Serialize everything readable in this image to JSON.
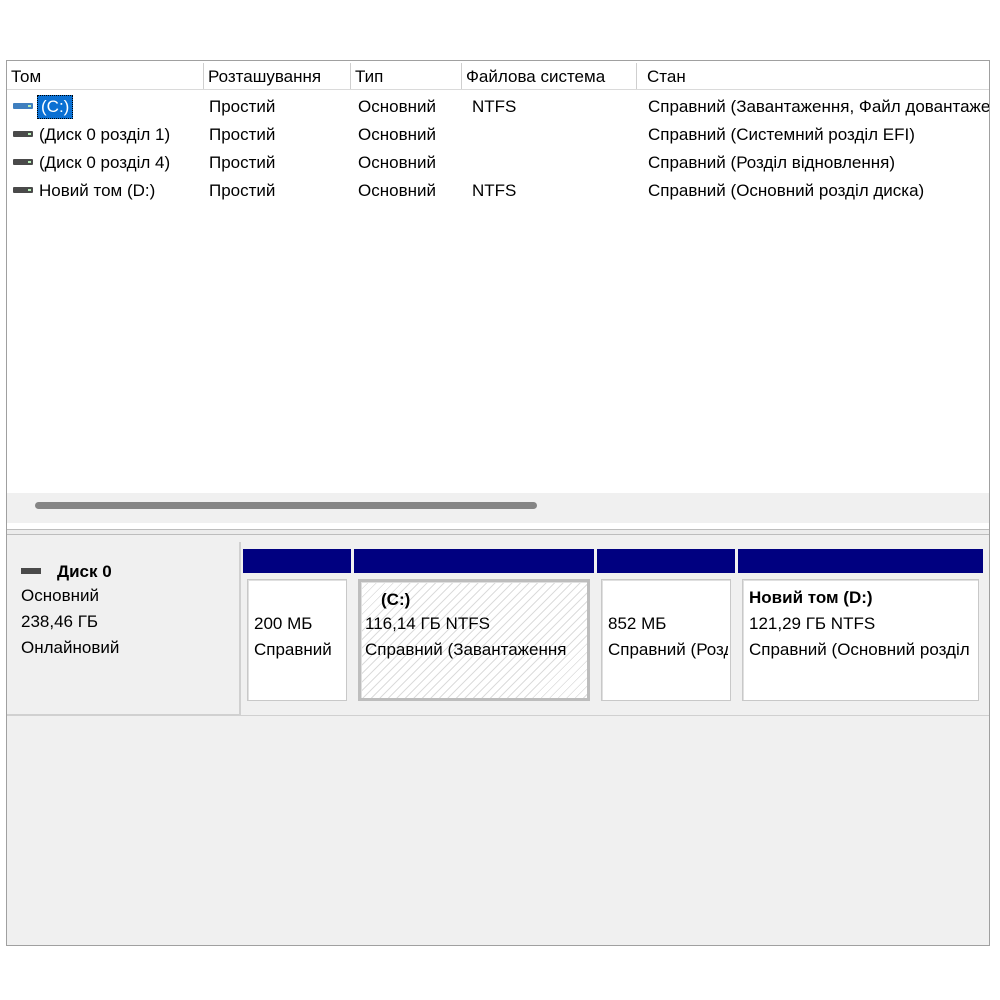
{
  "columns": [
    "Том",
    "Розташування",
    "Тип",
    "Файлова система",
    "Стан"
  ],
  "volumes": [
    {
      "name": "(C:)",
      "layout": "Простий",
      "type": "Основний",
      "fs": "NTFS",
      "status": "Справний (Завантаження, Файл довантаження"
    },
    {
      "name": "(Диск 0 розділ 1)",
      "layout": "Простий",
      "type": "Основний",
      "fs": "",
      "status": "Справний (Системний розділ EFI)"
    },
    {
      "name": "(Диск 0 розділ 4)",
      "layout": "Простий",
      "type": "Основний",
      "fs": "",
      "status": "Справний (Розділ відновлення)"
    },
    {
      "name": "Новий том (D:)",
      "layout": "Простий",
      "type": "Основний",
      "fs": "NTFS",
      "status": "Справний (Основний розділ диска)"
    }
  ],
  "disk": {
    "name": "Диск 0",
    "type": "Основний",
    "size": "238,46 ГБ",
    "state": "Онлайновий"
  },
  "partitions": [
    {
      "title": "",
      "size": "200 МБ",
      "status": "Справний"
    },
    {
      "title": "(C:)",
      "size": "116,14 ГБ NTFS",
      "status": "Справний (Завантаження"
    },
    {
      "title": "",
      "size": "852 МБ",
      "status": "Справний (Розділ"
    },
    {
      "title": "Новий том  (D:)",
      "size": "121,29 ГБ NTFS",
      "status": "Справний (Основний розділ"
    }
  ],
  "colors": {
    "partition_bar": "#000080",
    "selection": "#0a70d3"
  }
}
